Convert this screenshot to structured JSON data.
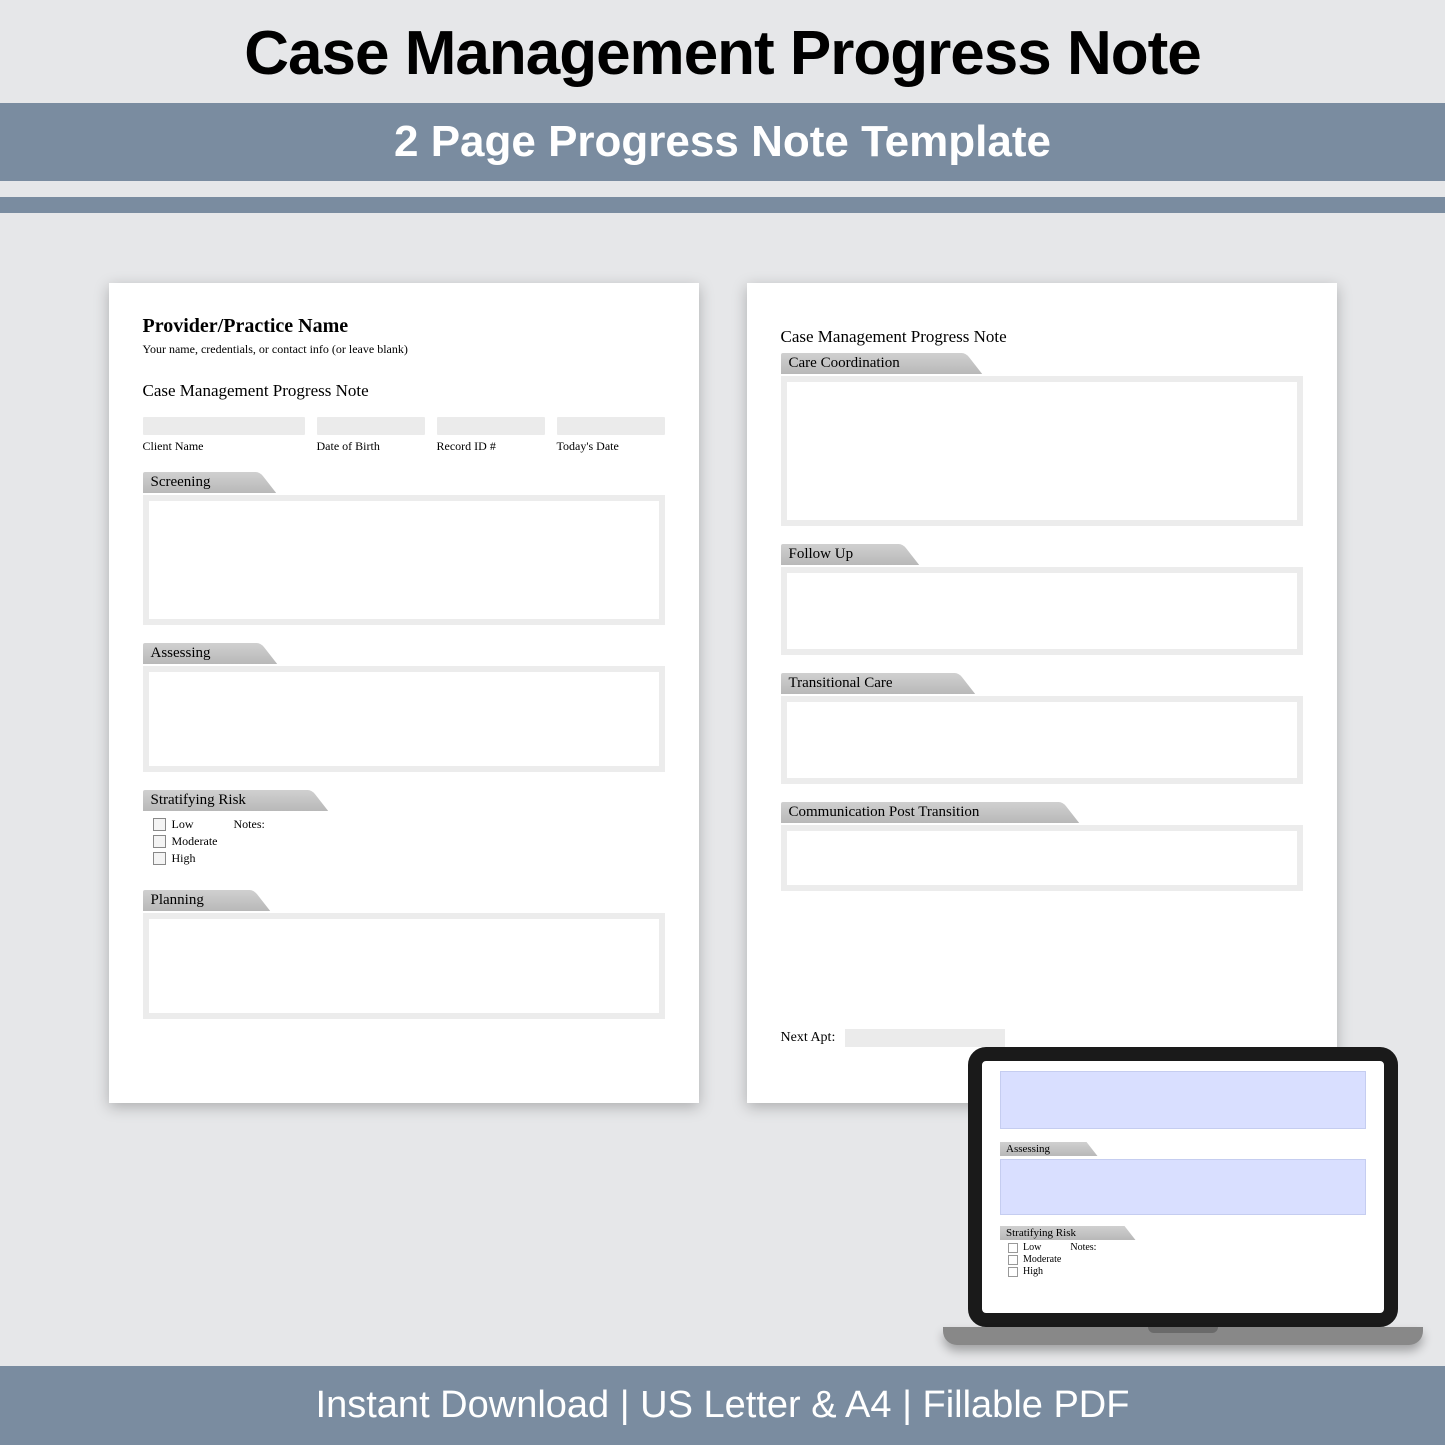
{
  "header": {
    "title": "Case Management Progress Note",
    "subtitle": "2 Page Progress Note Template"
  },
  "page1": {
    "provider_name": "Provider/Practice Name",
    "provider_sub": "Your name, credentials, or contact info (or leave blank)",
    "doc_title": "Case Management Progress Note",
    "fields": {
      "client_name": "Client Name",
      "dob": "Date of Birth",
      "record_id": "Record ID #",
      "today": "Today's Date"
    },
    "sections": {
      "screening": "Screening",
      "assessing": "Assessing",
      "stratifying": "Stratifying Risk",
      "planning": "Planning"
    },
    "risk": {
      "low": "Low",
      "moderate": "Moderate",
      "high": "High",
      "notes": "Notes:"
    }
  },
  "page2": {
    "doc_title": "Case Management Progress Note",
    "sections": {
      "care_coord": "Care Coordination",
      "follow_up": "Follow Up",
      "transitional": "Transitional Care",
      "comm_post": "Communication Post Transition"
    },
    "next_apt": "Next Apt:"
  },
  "laptop": {
    "assessing": "Assessing",
    "stratifying": "Stratifying Risk",
    "low": "Low",
    "moderate": "Moderate",
    "high": "High",
    "notes": "Notes:"
  },
  "footer": {
    "text": "Instant Download | US Letter & A4 | Fillable PDF"
  }
}
